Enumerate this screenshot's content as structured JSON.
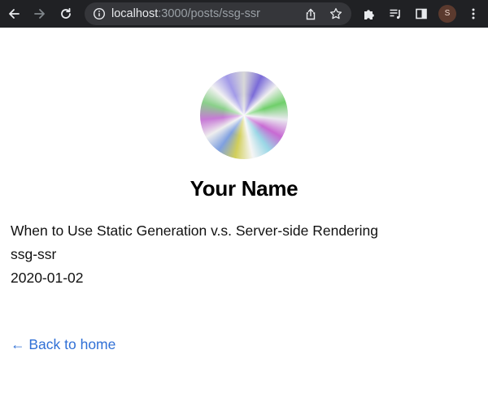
{
  "browser": {
    "url_host": "localhost",
    "url_rest": ":3000/posts/ssg-ssr",
    "profile_initial": "S"
  },
  "icons": {
    "back": "back-arrow-icon",
    "forward": "forward-arrow-icon",
    "reload": "reload-icon",
    "site_info": "info-icon",
    "share": "share-icon",
    "bookmark": "star-icon",
    "extensions": "puzzle-icon",
    "reading_list": "reading-list-icon",
    "side_panel": "side-panel-icon",
    "menu": "kebab-menu-icon"
  },
  "page": {
    "heading": "Your Name",
    "post": {
      "title": "When to Use Static Generation v.s. Server-side Rendering",
      "id": "ssg-ssr",
      "date": "2020-01-02"
    },
    "back_link": "← Back to home"
  },
  "colors": {
    "chrome_bg": "#202124",
    "omnibox_bg": "#35363a",
    "link": "#3070d6"
  }
}
